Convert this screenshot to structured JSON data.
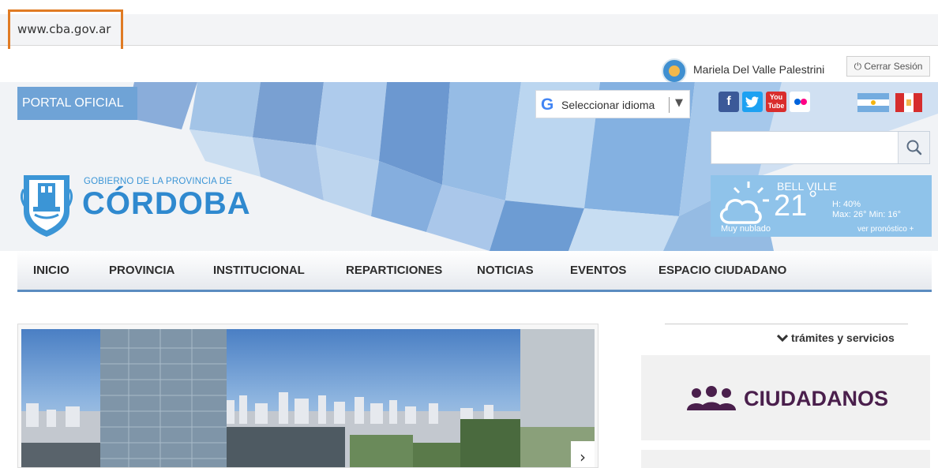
{
  "browser": {
    "url": "www.cba.gov.ar"
  },
  "user": {
    "name": "Mariela Del Valle Palestrini",
    "logout_label": "⏻ Cerrar Sesión"
  },
  "header": {
    "portal_label": "PORTAL OFICIAL",
    "language": {
      "g": "G",
      "label": "Seleccionar idioma",
      "arrow": "▼"
    },
    "social": [
      {
        "name": "facebook-icon",
        "glyph": "f"
      },
      {
        "name": "twitter-icon",
        "glyph": "🐦"
      },
      {
        "name": "youtube-icon",
        "glyph": "You\nTube"
      },
      {
        "name": "flickr-icon",
        "glyph": ""
      }
    ],
    "search": {
      "placeholder": ""
    },
    "logo": {
      "small": "GOBIERNO DE LA PROVINCIA DE",
      "big": "CÓRDOBA"
    },
    "weather": {
      "city": "BELL VILLE",
      "temp": "21",
      "deg": "°",
      "humidity": "H: 40%",
      "minmax": "Max: 26° Min: 16°",
      "desc": "Muy nublado",
      "more": "ver pronóstico +"
    }
  },
  "nav": {
    "items": [
      {
        "label": "INICIO"
      },
      {
        "label": "PROVINCIA"
      },
      {
        "label": "INSTITUCIONAL"
      },
      {
        "label": "REPARTICIONES"
      },
      {
        "label": "NOTICIAS"
      },
      {
        "label": "EVENTOS"
      },
      {
        "label": "ESPACIO CIUDADANO"
      }
    ]
  },
  "slider": {
    "next_arrow": "›",
    "prev_arrow": "‹"
  },
  "sidebar": {
    "tramites_label": "✔ trámites y servicios",
    "ciudadanos_label": "CIUDADANOS"
  },
  "colors": {
    "accent": "#2f89cf",
    "nav_border": "#5b8cc0",
    "url_highlight": "#e07b24",
    "ciudadanos": "#4a1f4c"
  }
}
